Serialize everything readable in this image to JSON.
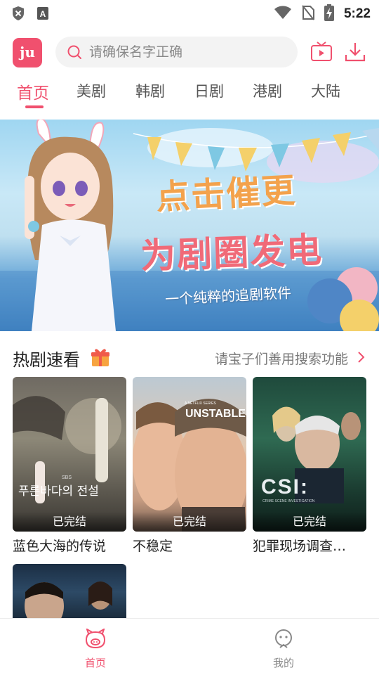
{
  "status_bar": {
    "time": "5:22"
  },
  "header": {
    "logo_text": "ju",
    "search_placeholder": "请确保名字正确"
  },
  "tabs": [
    {
      "label": "首页",
      "active": true
    },
    {
      "label": "美剧",
      "active": false
    },
    {
      "label": "韩剧",
      "active": false
    },
    {
      "label": "日剧",
      "active": false
    },
    {
      "label": "港剧",
      "active": false
    },
    {
      "label": "大陆",
      "active": false
    }
  ],
  "banner": {
    "line1": "点击催更",
    "line2": "为剧圈发电",
    "line3": "一个纯粹的追剧软件"
  },
  "section": {
    "title": "热剧速看",
    "link": "请宝子们善用搜索功能"
  },
  "dramas": [
    {
      "title": "蓝色大海的传说",
      "badge": "已完结",
      "poster_text": "푸른바다의 전설",
      "poster_small": "SBS"
    },
    {
      "title": "不稳定",
      "badge": "已完结",
      "poster_text": "UNSTABLE",
      "poster_small": "A NETFLIX SERIES"
    },
    {
      "title": "犯罪现场调查…",
      "badge": "已完结",
      "poster_text": "CSI:",
      "poster_small": "CRIME SCENE INVESTIGATION"
    },
    {
      "title": "",
      "badge": "",
      "poster_text": "",
      "poster_small": ""
    }
  ],
  "bottom_nav": [
    {
      "label": "首页",
      "active": true
    },
    {
      "label": "我的",
      "active": false
    }
  ],
  "colors": {
    "accent": "#f0506e",
    "inactive": "#888888"
  }
}
